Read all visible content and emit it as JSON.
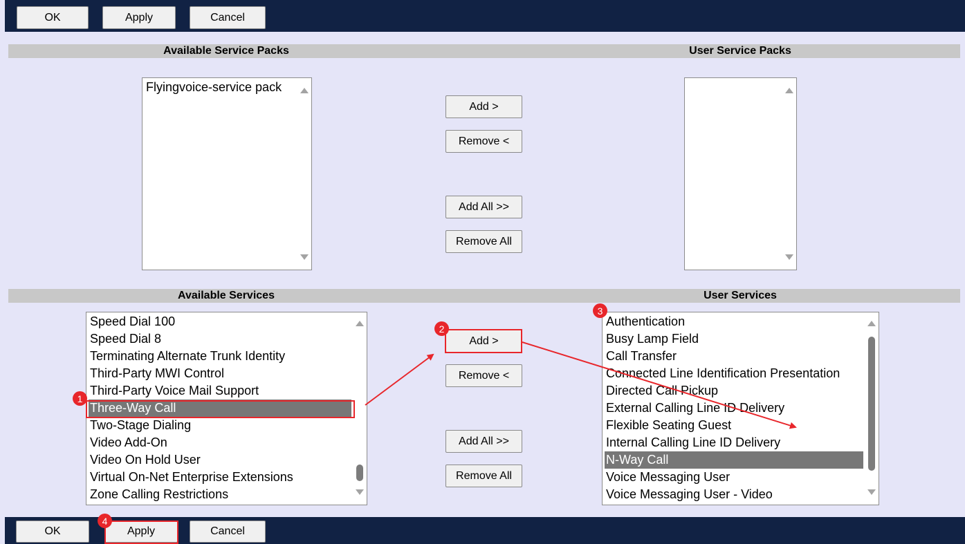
{
  "toolbar": {
    "ok": "OK",
    "apply": "Apply",
    "cancel": "Cancel"
  },
  "service_packs": {
    "available_header": "Available Service Packs",
    "user_header": "User Service Packs",
    "available_items": [
      "Flyingvoice-service pack"
    ],
    "user_items": [],
    "add": "Add >",
    "remove": "Remove <",
    "add_all": "Add All >>",
    "remove_all": "Remove All"
  },
  "services": {
    "available_header": "Available Services",
    "user_header": "User Services",
    "available_items": [
      "Speed Dial 100",
      "Speed Dial 8",
      "Terminating Alternate Trunk Identity",
      "Third-Party MWI Control",
      "Third-Party Voice Mail Support",
      "Three-Way Call",
      "Two-Stage Dialing",
      "Video Add-On",
      "Video On Hold User",
      "Virtual On-Net Enterprise Extensions",
      "Zone Calling Restrictions"
    ],
    "available_selected": "Three-Way Call",
    "user_items": [
      "Authentication",
      "Busy Lamp Field",
      "Call Transfer",
      "Connected Line Identification Presentation",
      "Directed Call Pickup",
      "External Calling Line ID Delivery",
      "Flexible Seating Guest",
      "Internal Calling Line ID Delivery",
      "N-Way Call",
      "Voice Messaging User",
      "Voice Messaging User - Video"
    ],
    "user_selected": "N-Way Call",
    "add": "Add >",
    "remove": "Remove <",
    "add_all": "Add All >>",
    "remove_all": "Remove All"
  },
  "annotations": {
    "step1": "1",
    "step2": "2",
    "step3": "3",
    "step4": "4",
    "color": "#e8262b"
  },
  "colors": {
    "bar": "#112244",
    "background": "#e5e5f8",
    "header": "#c8c8c8",
    "selected": "#777777"
  }
}
